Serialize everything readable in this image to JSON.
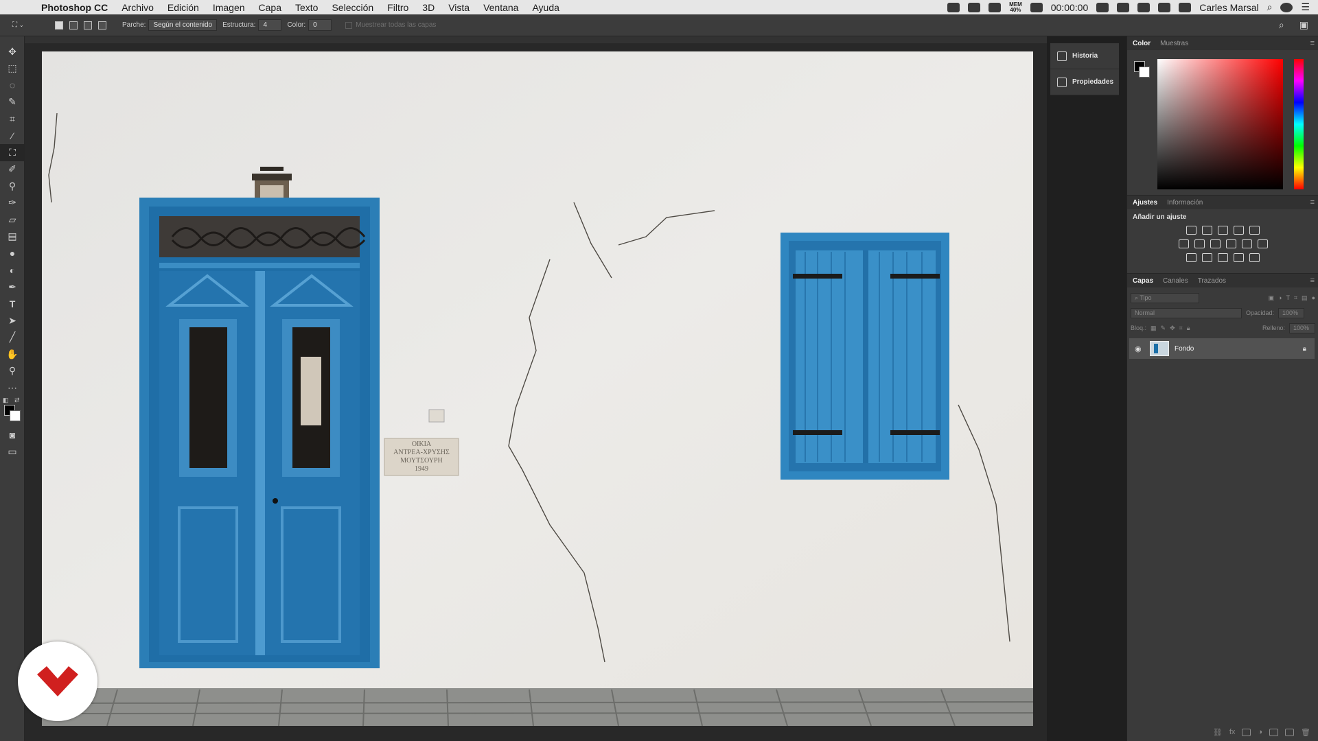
{
  "menubar": {
    "app_name": "Photoshop CC",
    "menus": [
      "Archivo",
      "Edición",
      "Imagen",
      "Capa",
      "Texto",
      "Selección",
      "Filtro",
      "3D",
      "Vista",
      "Ventana",
      "Ayuda"
    ],
    "mem_label": "MEM",
    "mem_value": "40%",
    "clock": "00:00:00",
    "user": "Carles Marsal"
  },
  "options": {
    "patch_label": "Parche:",
    "patch_value": "Según el contenido",
    "structure_label": "Estructura:",
    "structure_value": "4",
    "color_label": "Color:",
    "color_value": "0",
    "sample_all": "Muestrear todas las capas"
  },
  "dock": {
    "history": "Historia",
    "properties": "Propiedades"
  },
  "color_panel": {
    "tab_color": "Color",
    "tab_swatches": "Muestras",
    "foreground": "#000000",
    "background": "#ffffff",
    "hue": "#ff0000"
  },
  "adjustments": {
    "tab_adjust": "Ajustes",
    "tab_info": "Información",
    "add_label": "Añadir un ajuste"
  },
  "layers": {
    "tab_layers": "Capas",
    "tab_channels": "Canales",
    "tab_paths": "Trazados",
    "filter_placeholder": "Tipo",
    "blend_mode": "Normal",
    "opacity_label": "Opacidad:",
    "opacity_value": "100%",
    "lock_label": "Bloq.:",
    "fill_label": "Relleno:",
    "fill_value": "100%",
    "items": [
      {
        "name": "Fondo",
        "visible": true,
        "locked": true
      }
    ]
  },
  "document": {
    "plaque_lines": [
      "ΟΙΚΙΑ",
      "ΑΝΤΡΕΑ-ΧΡΥΣΗΣ",
      "ΜΟΥΤΣΟΥΡΗ",
      "1949"
    ],
    "accent": "#2a7fb8"
  }
}
